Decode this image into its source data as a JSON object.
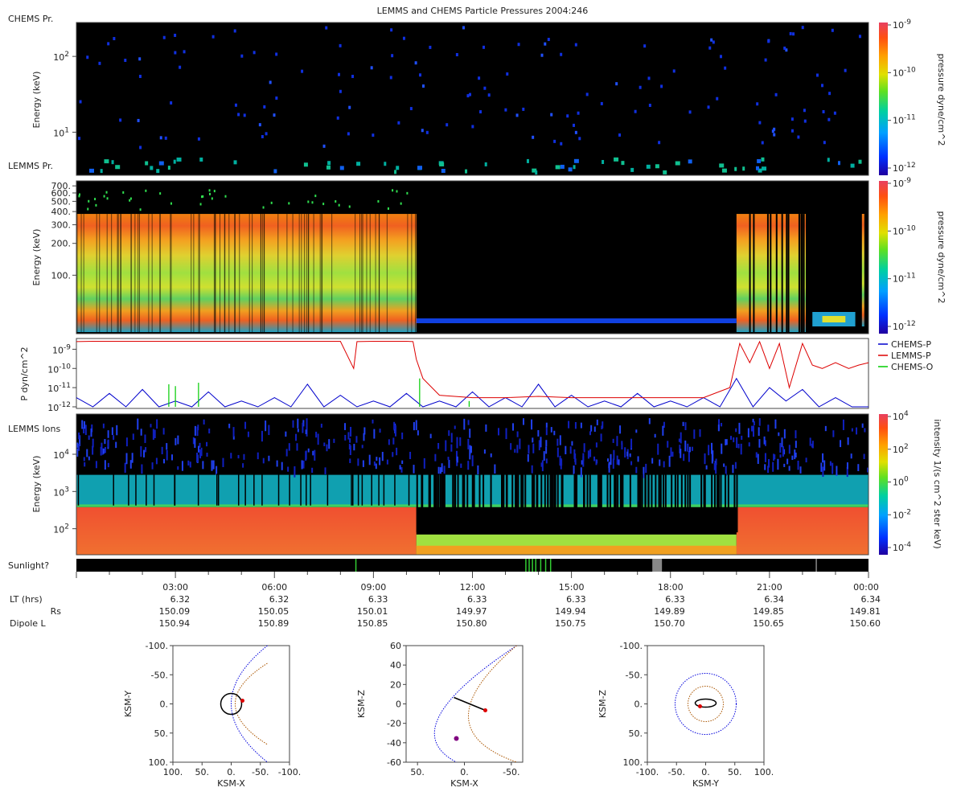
{
  "title": "LEMMS and CHEMS Particle Pressures  2004:246",
  "chart_data": [
    {
      "type": "heatmap",
      "panel": "chems-pressure",
      "panel_label_top": "CHEMS Pr.",
      "panel_label_bottom": "LEMMS Pr.",
      "ylabel": "Energy (keV)",
      "yscale": "log",
      "ylim": [
        2.7,
        280
      ],
      "yticks": [
        {
          "v": 10,
          "base": "10",
          "exp": "1"
        },
        {
          "v": 100,
          "base": "10",
          "exp": "2"
        }
      ],
      "colorbar_label": "pressure dyne/cm^2",
      "colorbar_ticks": [
        {
          "base": "10",
          "exp": "-9"
        },
        {
          "base": "10",
          "exp": "-10"
        },
        {
          "base": "10",
          "exp": "-11"
        },
        {
          "base": "10",
          "exp": "-12"
        }
      ],
      "background": "#000000",
      "description_hidden": false
    },
    {
      "type": "heatmap",
      "panel": "lemms-pressure",
      "ylabel": "Energy (keV)",
      "yscale": "log",
      "ylim": [
        28,
        780
      ],
      "ytick_labels": [
        "700.",
        "600.",
        "500.",
        "400.",
        "300.",
        "200.",
        "100."
      ],
      "ytick_values": [
        700,
        600,
        500,
        400,
        300,
        200,
        100
      ],
      "colorbar_label": "pressure dyne/cm^2",
      "colorbar_ticks": [
        {
          "base": "10",
          "exp": "-9"
        },
        {
          "base": "10",
          "exp": "-10"
        },
        {
          "base": "10",
          "exp": "-11"
        },
        {
          "base": "10",
          "exp": "-12"
        }
      ],
      "active_intervals_hours": [
        [
          0,
          10.3
        ],
        [
          20.0,
          21.2
        ],
        [
          21.2,
          22.1
        ]
      ],
      "background": "#000000"
    },
    {
      "type": "line",
      "panel": "pressure-lines",
      "ylabel": "P dyn/cm^2",
      "yscale": "log",
      "ylim": [
        1e-12,
        3e-09
      ],
      "yticks": [
        {
          "base": "10",
          "exp": "-9"
        },
        {
          "base": "10",
          "exp": "-10"
        },
        {
          "base": "10",
          "exp": "-11"
        },
        {
          "base": "10",
          "exp": "-12"
        }
      ],
      "xlim_hours": [
        0,
        24
      ],
      "series": [
        {
          "name": "CHEMS-P",
          "color": "#0000cc",
          "x": [
            0,
            0.5,
            1,
            1.5,
            2,
            2.5,
            3,
            3.5,
            4,
            4.5,
            5,
            5.5,
            6,
            6.5,
            7,
            7.5,
            8,
            8.5,
            9,
            9.5,
            10,
            10.5,
            11,
            11.5,
            12,
            12.5,
            13,
            13.5,
            14,
            14.5,
            15,
            15.5,
            16,
            16.5,
            17,
            17.5,
            18,
            18.5,
            19,
            19.5,
            20,
            20.5,
            21,
            21.5,
            22,
            22.5,
            23,
            23.5,
            24
          ],
          "y": [
            3e-12,
            1e-12,
            5e-12,
            1e-12,
            8e-12,
            1e-12,
            2e-12,
            1e-12,
            6e-12,
            1e-12,
            2e-12,
            1e-12,
            3e-12,
            1e-12,
            1.5e-11,
            1e-12,
            4e-12,
            1e-12,
            2e-12,
            1e-12,
            5e-12,
            1e-12,
            2e-12,
            1e-12,
            6e-12,
            1e-12,
            3e-12,
            1e-12,
            1.5e-11,
            1e-12,
            4e-12,
            1e-12,
            2e-12,
            1e-12,
            5e-12,
            1e-12,
            2e-12,
            1e-12,
            3e-12,
            1e-12,
            3e-11,
            1e-12,
            1e-11,
            2e-12,
            8e-12,
            1e-12,
            3e-12,
            1e-12,
            1e-12
          ]
        },
        {
          "name": "LEMMS-P",
          "color": "#dd0000",
          "x": [
            0,
            0.5,
            1,
            2,
            3,
            4,
            5,
            6,
            7,
            8,
            8.4,
            8.5,
            9,
            9.5,
            10,
            10.2,
            10.3,
            10.5,
            11,
            12,
            13,
            14,
            15,
            16,
            17,
            18,
            19,
            19.8,
            20.1,
            20.4,
            20.7,
            21,
            21.3,
            21.6,
            22,
            22.3,
            22.6,
            23,
            23.4,
            23.7,
            24
          ],
          "y": [
            2.5e-09,
            2.6e-09,
            2.6e-09,
            2.6e-09,
            2.6e-09,
            2.6e-09,
            2.6e-09,
            2.6e-09,
            2.6e-09,
            2.6e-09,
            1e-10,
            2.5e-09,
            2.6e-09,
            2.6e-09,
            2.6e-09,
            2.5e-09,
            3e-10,
            3e-11,
            4e-12,
            3e-12,
            3e-12,
            3.5e-12,
            3e-12,
            3e-12,
            3e-12,
            3e-12,
            3e-12,
            1e-11,
            2e-09,
            2e-10,
            2.5e-09,
            1e-10,
            2e-09,
            1e-11,
            2e-09,
            1.5e-10,
            1e-10,
            2e-10,
            1e-10,
            1.5e-10,
            2e-10
          ]
        },
        {
          "name": "CHEMS-O",
          "color": "#00cc00",
          "x": [
            2.8,
            3.0,
            3.7,
            10.4,
            11.9,
            15.4
          ],
          "y": [
            1.5e-11,
            1.2e-11,
            1.8e-11,
            3e-11,
            2e-12,
            1e-12
          ]
        }
      ]
    },
    {
      "type": "heatmap",
      "panel": "lemms-ions",
      "panel_label": "LEMMS Ions",
      "ylabel": "Energy (keV)",
      "yscale": "log",
      "ylim": [
        20,
        120000
      ],
      "yticks": [
        {
          "v": 100,
          "base": "10",
          "exp": "2"
        },
        {
          "v": 1000,
          "base": "10",
          "exp": "3"
        },
        {
          "v": 10000,
          "base": "10",
          "exp": "4"
        }
      ],
      "colorbar_label": "intensity 1/(s cm^2 ster keV)",
      "colorbar_ticks": [
        {
          "base": "10",
          "exp": "4"
        },
        {
          "base": "10",
          "exp": "2"
        },
        {
          "base": "10",
          "exp": "0"
        },
        {
          "base": "10",
          "exp": "-2"
        },
        {
          "base": "10",
          "exp": "-4"
        }
      ]
    },
    {
      "type": "table",
      "panel": "ephemeris",
      "sunlight_label": "Sunlight?",
      "row_labels": [
        "LT (hrs)",
        "Rs",
        "Dipole L"
      ],
      "columns": [
        {
          "time": "03:00",
          "lt": "6.32",
          "rs": "150.09",
          "l": "150.94"
        },
        {
          "time": "06:00",
          "lt": "6.32",
          "rs": "150.05",
          "l": "150.89"
        },
        {
          "time": "09:00",
          "lt": "6.33",
          "rs": "150.01",
          "l": "150.85"
        },
        {
          "time": "12:00",
          "lt": "6.33",
          "rs": "149.97",
          "l": "150.80"
        },
        {
          "time": "15:00",
          "lt": "6.33",
          "rs": "149.94",
          "l": "150.75"
        },
        {
          "time": "18:00",
          "lt": "6.33",
          "rs": "149.89",
          "l": "150.70"
        },
        {
          "time": "21:00",
          "lt": "6.34",
          "rs": "149.85",
          "l": "150.65"
        },
        {
          "time": "00:00",
          "lt": "6.34",
          "rs": "149.81",
          "l": "150.60"
        }
      ]
    },
    {
      "type": "scatter",
      "panel": "orbit-xy",
      "xlabel": "KSM-X",
      "ylabel": "KSM-Y",
      "xlim": [
        100,
        -100
      ],
      "ylim": [
        -100,
        100
      ],
      "xticks": [
        "100.",
        "50.",
        "0.",
        "-50.",
        "-100."
      ],
      "yticks": [
        "-100.",
        "-50.",
        "0.",
        "50.",
        "100."
      ]
    },
    {
      "type": "scatter",
      "panel": "orbit-xz",
      "xlabel": "KSM-X",
      "ylabel": "KSM-Z",
      "xlim": [
        70,
        -70
      ],
      "ylim": [
        -70,
        70
      ],
      "xticks": [
        "50.",
        "0.",
        "-50."
      ],
      "yticks": [
        "60",
        "40",
        "20",
        "0",
        "-20",
        "-40",
        "-60"
      ]
    },
    {
      "type": "scatter",
      "panel": "orbit-yz",
      "xlabel": "KSM-Y",
      "ylabel": "KSM-Z",
      "xlim": [
        -100,
        100
      ],
      "ylim": [
        -100,
        100
      ],
      "xticks": [
        "-100.",
        "-50.",
        "0.",
        "50.",
        "100."
      ],
      "yticks": [
        "-100.",
        "-50.",
        "0.",
        "50.",
        "100."
      ]
    }
  ],
  "colors": {
    "sunlight_gray": "#888888",
    "sunlight_green": "#33cc33",
    "bow_shock": "#0000dd",
    "magnetopause": "#aa5500",
    "spacecraft": "#dd0000"
  }
}
